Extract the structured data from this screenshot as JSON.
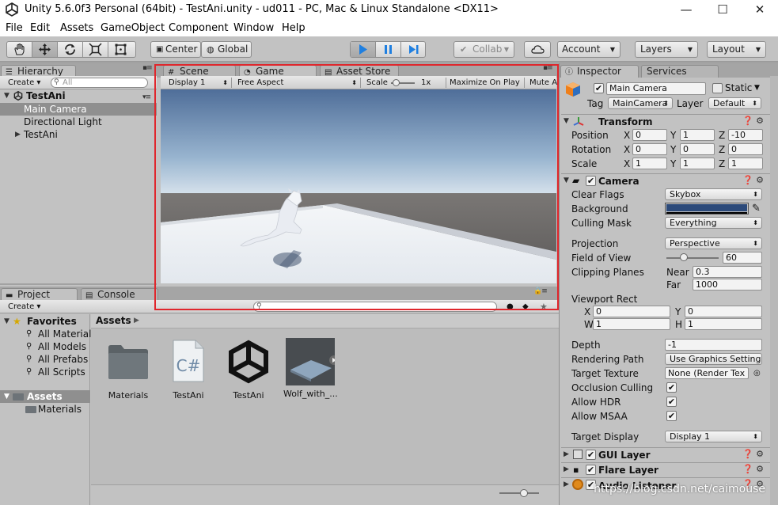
{
  "window": {
    "title": "Unity 5.6.0f3 Personal (64bit) - TestAni.unity - ud011 - PC, Mac & Linux Standalone <DX11>",
    "minimize": "—",
    "maximize": "☐",
    "close": "✕"
  },
  "menu": [
    "File",
    "Edit",
    "Assets",
    "GameObject",
    "Component",
    "Window",
    "Help"
  ],
  "toolbar": {
    "pivot": "Center",
    "space": "Global",
    "collab": "Collab",
    "account": "Account",
    "layers": "Layers",
    "layout": "Layout",
    "play_color": "#1f7fe0"
  },
  "hierarchy": {
    "tab": "Hierarchy",
    "create": "Create",
    "search_placeholder": "All",
    "scene": "TestAni",
    "items": [
      "Main Camera",
      "Directional Light",
      "TestAni"
    ]
  },
  "center": {
    "tabs": [
      "Scene",
      "Game",
      "Asset Store"
    ],
    "display": "Display 1",
    "aspect": "Free Aspect",
    "scale_label": "Scale",
    "scale_value": "1x",
    "maximize": "Maximize On Play",
    "mute": "Mute A"
  },
  "project": {
    "tabs": [
      "Project",
      "Console"
    ],
    "create": "Create",
    "favorites_label": "Favorites",
    "favorites": [
      "All Materials",
      "All Models",
      "All Prefabs",
      "All Scripts"
    ],
    "assets_label": "Assets",
    "asset_children": [
      "Materials"
    ],
    "breadcrumb": "Assets",
    "assets": [
      {
        "name": "Materials",
        "icon": "folder-icon"
      },
      {
        "name": "TestAni",
        "icon": "csharp-script-icon"
      },
      {
        "name": "TestAni",
        "icon": "unity-scene-icon"
      },
      {
        "name": "Wolf_with_...",
        "icon": "model-prefab-icon"
      }
    ]
  },
  "inspector": {
    "tabs": [
      "Inspector",
      "Services"
    ],
    "object_name": "Main Camera",
    "static_label": "Static",
    "tag_label": "Tag",
    "tag": "MainCamera",
    "layer_label": "Layer",
    "layer": "Default",
    "transform": {
      "title": "Transform",
      "position_label": "Position",
      "rotation_label": "Rotation",
      "scale_label": "Scale",
      "position": [
        "0",
        "1",
        "-10"
      ],
      "rotation": [
        "0",
        "0",
        "0"
      ],
      "scale": [
        "1",
        "1",
        "1"
      ]
    },
    "camera": {
      "title": "Camera",
      "clear_flags_label": "Clear Flags",
      "clear_flags": "Skybox",
      "background_label": "Background",
      "background_color": "#2c4a7a",
      "culling_mask_label": "Culling Mask",
      "culling_mask": "Everything",
      "projection_label": "Projection",
      "projection": "Perspective",
      "fov_label": "Field of View",
      "fov": "60",
      "fov_fraction": 0.33,
      "clipping_label": "Clipping Planes",
      "near_label": "Near",
      "near": "0.3",
      "far_label": "Far",
      "far": "1000",
      "viewport_label": "Viewport Rect",
      "viewport": {
        "x": "0",
        "y": "0",
        "w": "1",
        "h": "1"
      },
      "depth_label": "Depth",
      "depth": "-1",
      "rendering_path_label": "Rendering Path",
      "rendering_path": "Use Graphics Setting",
      "target_texture_label": "Target Texture",
      "target_texture": "None (Render Tex",
      "occlusion_label": "Occlusion Culling",
      "hdr_label": "Allow HDR",
      "msaa_label": "Allow MSAA",
      "target_display_label": "Target Display",
      "target_display": "Display 1"
    },
    "components": [
      "GUI Layer",
      "Flare Layer",
      "Audio Listener"
    ]
  },
  "watermark": "https://blog.csdn.net/caimouse",
  "highlight_color": "#e0262c"
}
